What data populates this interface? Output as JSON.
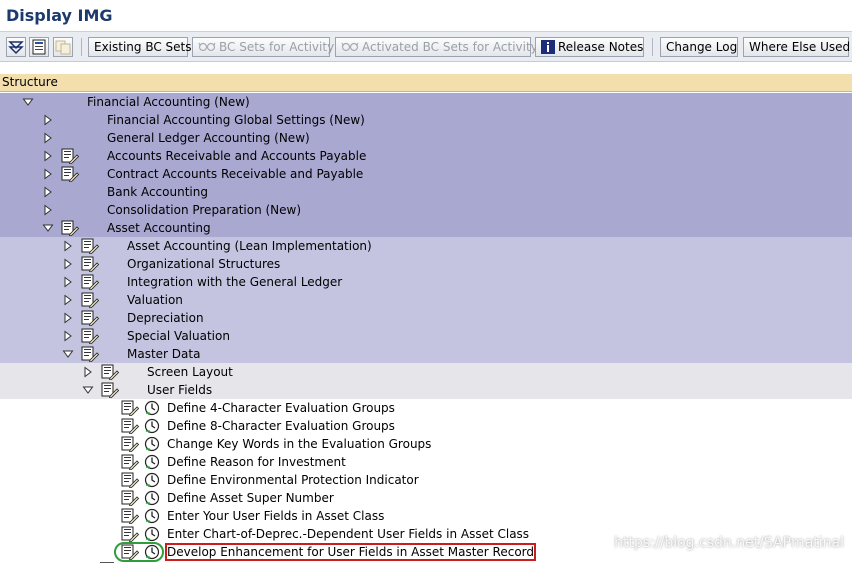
{
  "window": {
    "title": "Display IMG"
  },
  "toolbar": {
    "buttons": [
      {
        "label": "Existing BC Sets",
        "enabled": true
      },
      {
        "label": "BC Sets for Activity",
        "enabled": false
      },
      {
        "label": "Activated BC Sets for Activity",
        "enabled": false
      },
      {
        "label": "Release Notes",
        "enabled": true
      },
      {
        "label": "Change Log",
        "enabled": true
      },
      {
        "label": "Where Else Used",
        "enabled": true
      }
    ]
  },
  "tree": {
    "header": "Structure",
    "root": "Financial Accounting (New)",
    "level1": [
      "Financial Accounting Global Settings (New)",
      "General Ledger Accounting (New)",
      "Accounts Receivable and Accounts Payable",
      "Contract Accounts Receivable and Payable",
      "Bank Accounting",
      "Consolidation Preparation (New)",
      "Asset Accounting"
    ],
    "level2": [
      "Asset Accounting (Lean Implementation)",
      "Organizational Structures",
      "Integration with the General Ledger",
      "Valuation",
      "Depreciation",
      "Special Valuation",
      "Master Data"
    ],
    "level3": [
      "Screen Layout",
      "User Fields"
    ],
    "activities": [
      "Define 4-Character Evaluation Groups",
      "Define 8-Character Evaluation Groups",
      "Change Key Words in the Evaluation Groups",
      "Define Reason for Investment",
      "Define Environmental Protection Indicator",
      "Define Asset Super Number",
      "Enter Your User Fields in Asset Class",
      "Enter Chart-of-Deprec.-Dependent User Fields in Asset Class",
      "Develop Enhancement for User Fields in Asset Master Record"
    ],
    "selected_activity": "Develop Enhancement for User Fields in Asset Master Record"
  },
  "watermark": "https://blog.csdn.net/SAPmatinal",
  "colors": {
    "band_level1": "#a9a8d0",
    "band_level2": "#c5c4e0",
    "band_level3": "#e6e6ea",
    "highlight": "#cc1d1d",
    "circle": "#2e9d3a",
    "title": "#1c3a6e"
  }
}
